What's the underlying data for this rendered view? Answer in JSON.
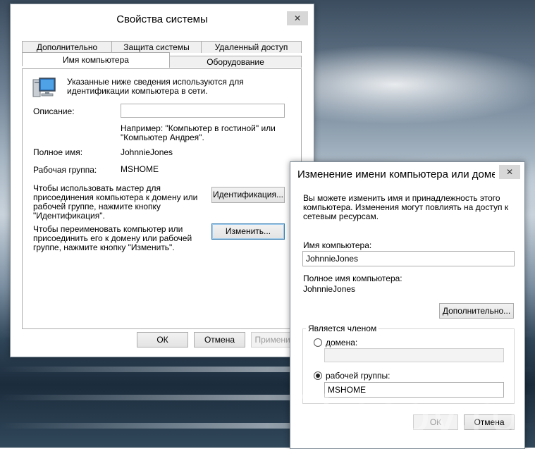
{
  "main_dialog": {
    "title": "Свойства системы",
    "close_glyph": "✕",
    "tabs_top": [
      "Дополнительно",
      "Защита системы",
      "Удаленный доступ"
    ],
    "tabs_bottom": [
      "Имя компьютера",
      "Оборудование"
    ],
    "active_tab": "Имя компьютера",
    "intro_text": "Указанные ниже сведения используются для\nидентификации компьютера в сети.",
    "description_label": "Описание:",
    "description_value": "",
    "example_text": "Например: \"Компьютер в гостиной\" или\n\"Компьютер Андрея\".",
    "full_name_label": "Полное имя:",
    "full_name_value": "JohnnieJones",
    "workgroup_label": "Рабочая группа:",
    "workgroup_value": "MSHOME",
    "wizard_text": "Чтобы использовать мастер для\nприсоединения компьютера к домену или\nрабочей группе, нажмите кнопку\n\"Идентификация\".",
    "identification_button": "Идентификация...",
    "rename_text": "Чтобы переименовать компьютер или\nприсоединить его к домену или рабочей\nгруппе, нажмите кнопку \"Изменить\".",
    "change_button": "Изменить...",
    "ok_button": "ОК",
    "cancel_button": "Отмена",
    "apply_button": "Применить"
  },
  "rename_dialog": {
    "title": "Изменение имени компьютера или домена",
    "close_glyph": "✕",
    "intro_text": "Вы можете изменить имя и принадлежность этого\nкомпьютера. Изменения могут повлиять на доступ к\nсетевым ресурсам.",
    "computer_name_label": "Имя компьютера:",
    "computer_name_value": "JohnnieJones",
    "full_name_label": "Полное имя компьютера:",
    "full_name_value": "JohnnieJones",
    "more_button": "Дополнительно...",
    "member_group_title": "Является членом",
    "domain_label": "домена:",
    "domain_value": "",
    "workgroup_label": "рабочей группы:",
    "workgroup_value": "MSHOME",
    "ok_button": "ОК",
    "cancel_button": "Отмена"
  },
  "watermark": "Skesov.ru",
  "icons": {
    "computer": "computer-icon"
  }
}
